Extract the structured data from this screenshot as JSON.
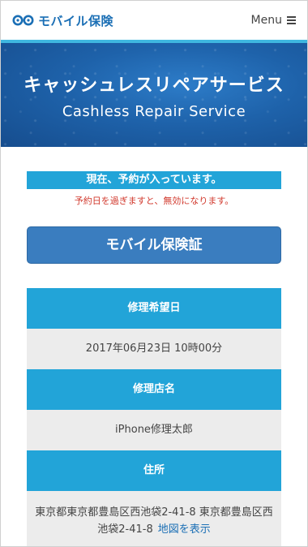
{
  "header": {
    "logo_text": "モバイル保険",
    "menu_label": "Menu"
  },
  "hero": {
    "title": "キャッシュレスリペアサービス",
    "subtitle": "Cashless Repair Service"
  },
  "reservation": {
    "status": "現在、予約が入っています。",
    "warning": "予約日を過ぎますと、無効になります。",
    "certificate_button": "モバイル保険証"
  },
  "details": {
    "date_label": "修理希望日",
    "date_value": "2017年06月23日 10時00分",
    "shop_label": "修理店名",
    "shop_value": "iPhone修理太郎",
    "address_label": "住所",
    "address_value": "東京都東京都豊島区西池袋2-41-8 東京都豊島区西池袋2-41-8",
    "map_link": "地図を表示"
  },
  "colors": {
    "accent": "#22a4d8",
    "brand": "#1b6fb5",
    "button": "#3a7dbf",
    "warning": "#d1382c"
  }
}
